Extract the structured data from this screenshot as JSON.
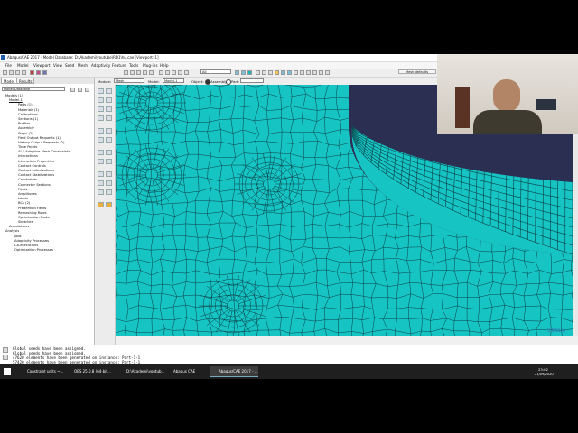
{
  "window": {
    "title": "Abaqus/CAE 2017 - Model Database: D:\\Akademi\\youtube\\RD1\\hu.cae [Viewport: 1]"
  },
  "menu": [
    "File",
    "Model",
    "Viewport",
    "View",
    "Seed",
    "Mesh",
    "Adaptivity",
    "Feature",
    "Tools",
    "Plug-ins",
    "Help"
  ],
  "toolbar": {
    "render_select": "All",
    "mesh_defaults": "Mesh defaults"
  },
  "context_bar": {
    "module_label": "Module:",
    "module_value": "Mesh",
    "model_label": "Model:",
    "model_value": "Model-1",
    "object_label": "Object:",
    "assembly_label": "Assembly",
    "part_label": "Part:"
  },
  "left_panel": {
    "tabs": [
      "Model",
      "Results"
    ],
    "db_select": "Model Database",
    "tree": [
      "Models (1)",
      "Model-1",
      "Parts (1)",
      "Materials (1)",
      "Calibrations",
      "Sections (1)",
      "Profiles",
      "Assembly",
      "Steps (2)",
      "Field Output Requests (1)",
      "History Output Requests (2)",
      "Time Points",
      "ALE Adaptive Mesh Constraints",
      "Interactions",
      "Interaction Properties",
      "Contact Controls",
      "Contact Initializations",
      "Contact Stabilizations",
      "Constraints",
      "Connector Sections",
      "Fields",
      "Amplitudes",
      "Loads",
      "BCs (2)",
      "Predefined Fields",
      "Remeshing Rules",
      "Optimization Tasks",
      "Sketches",
      "Annotations",
      "Analysis",
      "Jobs",
      "Adaptivity Processes",
      "Co-executions",
      "Optimization Processes"
    ]
  },
  "viewport": {
    "brand": "SIMULIA",
    "mesh_color": "#17c4c4",
    "line_color": "#0a3f44",
    "background_color": "#2b2f52"
  },
  "messages": [
    "Global seeds have been assigned.",
    "Global seeds have been assigned.",
    "47620 elements have been generated on instance: Part-1-1",
    "57420 elements have been generated on instance: Part-1-1"
  ],
  "taskbar": {
    "items": [
      "Constraint units ~...",
      "OBS 25.0.8 (64-bit...",
      "D:\\Akademi\\youtub...",
      "Abaqus CAE",
      "Abaqus/CAE 2017 - ..."
    ],
    "time": "23:02",
    "date": "21/09/2020"
  }
}
